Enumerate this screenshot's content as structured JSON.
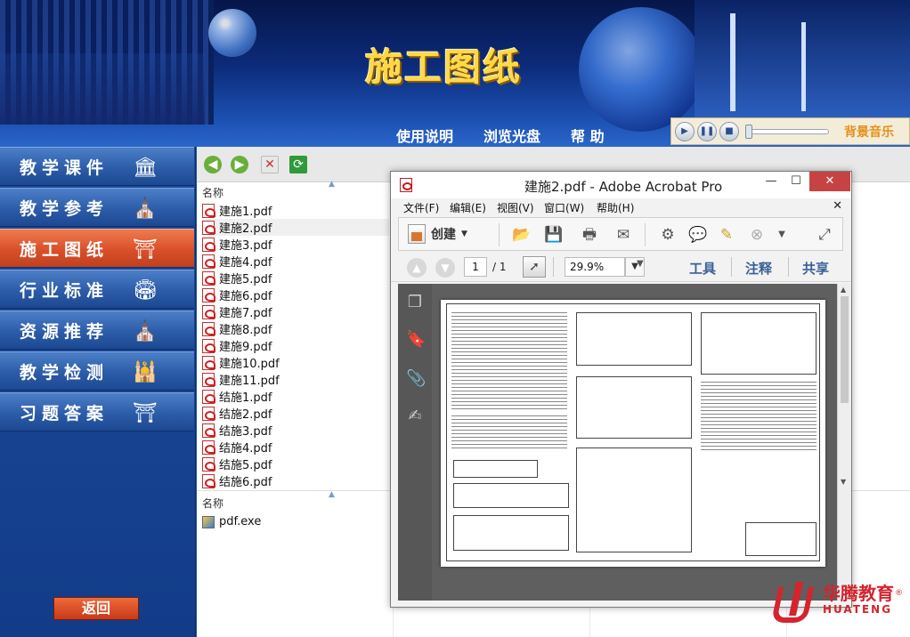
{
  "banner": {
    "title": "施工图纸",
    "menu": [
      "使用说明",
      "浏览光盘",
      "帮 助"
    ]
  },
  "player": {
    "label": "背景音乐",
    "position": 0.0
  },
  "nav": {
    "items": [
      {
        "label": "教学课件",
        "icon": "classical-building-icon",
        "active": false
      },
      {
        "label": "教学参考",
        "icon": "cathedral-icon",
        "active": false
      },
      {
        "label": "施工图纸",
        "icon": "temple-icon",
        "active": true
      },
      {
        "label": "行业标准",
        "icon": "colosseum-icon",
        "active": false
      },
      {
        "label": "资源推荐",
        "icon": "cathedral-icon",
        "active": false
      },
      {
        "label": "教学检测",
        "icon": "dome-building-icon",
        "active": false
      },
      {
        "label": "习题答案",
        "icon": "temple-icon",
        "active": false
      }
    ],
    "back_label": "返回"
  },
  "explorer": {
    "column_name": "名称",
    "files": [
      "建施1.pdf",
      "建施2.pdf",
      "建施3.pdf",
      "建施4.pdf",
      "建施5.pdf",
      "建施6.pdf",
      "建施7.pdf",
      "建施8.pdf",
      "建施9.pdf",
      "建施10.pdf",
      "建施11.pdf",
      "结施1.pdf",
      "结施2.pdf",
      "结施3.pdf",
      "结施4.pdf",
      "结施5.pdf",
      "结施6.pdf"
    ],
    "selected_index": 1,
    "column_name_2": "名称",
    "exe_file": "pdf.exe"
  },
  "acrobat": {
    "title": "建施2.pdf - Adobe Acrobat Pro",
    "menu": [
      "文件(F)",
      "编辑(E)",
      "视图(V)",
      "窗口(W)",
      "帮助(H)"
    ],
    "create_label": "创建",
    "page_current": "1",
    "page_total": "/ 1",
    "zoom": "29.9%",
    "panels": [
      "工具",
      "注释",
      "共享"
    ]
  },
  "logo": {
    "cn": "华腾教育",
    "en": "HUATENG",
    "reg": "®"
  },
  "colors": {
    "nav_active": "#d8502a",
    "nav_normal": "#2c5ca8",
    "title_gold": "#ffd84a",
    "brand_red": "#d4242e"
  }
}
